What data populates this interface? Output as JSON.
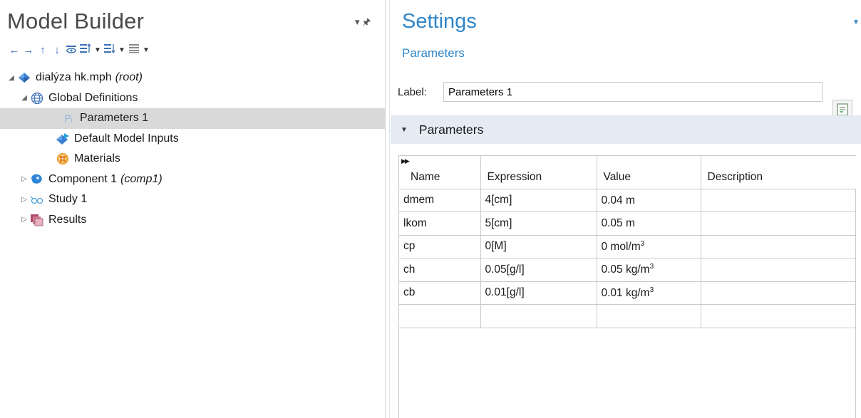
{
  "model_builder": {
    "title": "Model Builder",
    "toolbar": [
      "arrow-left-icon",
      "arrow-right-icon",
      "arrow-up-icon",
      "arrow-down-icon",
      "eye-icon",
      "expand-all-icon",
      "collapse-all-icon",
      "list-icon"
    ],
    "tree": {
      "root": {
        "label": "dialýza hk.mph",
        "tag": "(root)"
      },
      "global_definitions": "Global Definitions",
      "parameters": "Parameters 1",
      "default_model_inputs": "Default Model Inputs",
      "materials": "Materials",
      "component": {
        "label": "Component 1",
        "tag": "(comp1)"
      },
      "study": "Study 1",
      "results": "Results"
    }
  },
  "settings": {
    "title": "Settings",
    "subtitle": "Parameters",
    "label_caption": "Label:",
    "label_value": "Parameters 1",
    "section_title": "Parameters",
    "table": {
      "headers": [
        "Name",
        "Expression",
        "Value",
        "Description"
      ],
      "rows": [
        {
          "name": "dmem",
          "expression": "4[cm]",
          "value": "0.04 m",
          "unit_sup": "",
          "description": ""
        },
        {
          "name": "lkom",
          "expression": "5[cm]",
          "value": "0.05 m",
          "unit_sup": "",
          "description": ""
        },
        {
          "name": "cp",
          "expression": "0[M]",
          "value": "0 mol/m",
          "unit_sup": "3",
          "description": ""
        },
        {
          "name": "ch",
          "expression": "0.05[g/l]",
          "value": "0.05 kg/m",
          "unit_sup": "3",
          "description": ""
        },
        {
          "name": "cb",
          "expression": "0.01[g/l]",
          "value": "0.01 kg/m",
          "unit_sup": "3",
          "description": ""
        },
        {
          "name": "",
          "expression": "",
          "value": "",
          "unit_sup": "",
          "description": ""
        }
      ]
    }
  },
  "colors": {
    "accent": "#2f86c9",
    "section_bg": "#e4ebf2",
    "selection": "#d9d9d9"
  }
}
